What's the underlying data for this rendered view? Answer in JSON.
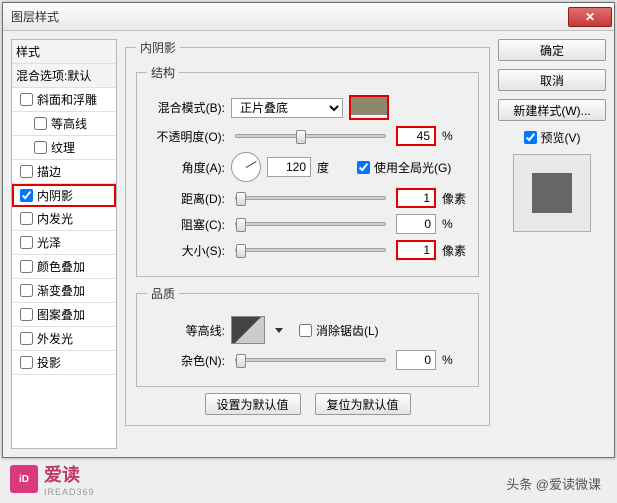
{
  "window": {
    "title": "图层样式"
  },
  "styles": {
    "header": "样式",
    "blendDefault": "混合选项:默认",
    "items": [
      {
        "label": "斜面和浮雕",
        "checked": false
      },
      {
        "label": "等高线",
        "checked": false,
        "indent": true
      },
      {
        "label": "纹理",
        "checked": false,
        "indent": true
      },
      {
        "label": "描边",
        "checked": false
      },
      {
        "label": "内阴影",
        "checked": true,
        "selected": true
      },
      {
        "label": "内发光",
        "checked": false
      },
      {
        "label": "光泽",
        "checked": false
      },
      {
        "label": "颜色叠加",
        "checked": false
      },
      {
        "label": "渐变叠加",
        "checked": false
      },
      {
        "label": "图案叠加",
        "checked": false
      },
      {
        "label": "外发光",
        "checked": false
      },
      {
        "label": "投影",
        "checked": false
      }
    ]
  },
  "panel": {
    "title": "内阴影",
    "structure": {
      "legend": "结构",
      "blendModeLabel": "混合模式(B):",
      "blendModeValue": "正片叠底",
      "swatchColor": "#8a8868",
      "opacityLabel": "不透明度(O):",
      "opacityValue": "45",
      "opacityUnit": "%",
      "angleLabel": "角度(A):",
      "angleValue": "120",
      "angleUnit": "度",
      "globalLightLabel": "使用全局光(G)",
      "globalLightChecked": true,
      "distanceLabel": "距离(D):",
      "distanceValue": "1",
      "distanceUnit": "像素",
      "chokeLabel": "阻塞(C):",
      "chokeValue": "0",
      "chokeUnit": "%",
      "sizeLabel": "大小(S):",
      "sizeValue": "1",
      "sizeUnit": "像素"
    },
    "quality": {
      "legend": "品质",
      "contourLabel": "等高线:",
      "antiAliasLabel": "消除锯齿(L)",
      "antiAliasChecked": false,
      "noiseLabel": "杂色(N):",
      "noiseValue": "0",
      "noiseUnit": "%"
    },
    "buttons": {
      "setDefault": "设置为默认值",
      "resetDefault": "复位为默认值"
    }
  },
  "right": {
    "ok": "确定",
    "cancel": "取消",
    "newStyle": "新建样式(W)...",
    "previewLabel": "预览(V)",
    "previewChecked": true
  },
  "footer": {
    "brand": "爱读",
    "brandSub": "IREAD369",
    "credit": "头条 @爱读微课"
  }
}
